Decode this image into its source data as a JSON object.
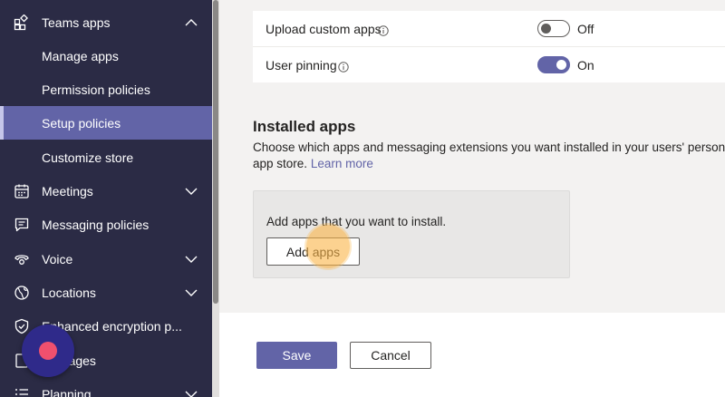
{
  "sidebar": {
    "items": [
      {
        "label": "Teams apps",
        "icon": "apps-icon",
        "chevron": "up"
      },
      {
        "label": "Manage apps"
      },
      {
        "label": "Permission policies"
      },
      {
        "label": "Setup policies",
        "selected": true
      },
      {
        "label": "Customize store"
      },
      {
        "label": "Meetings",
        "icon": "calendar-icon",
        "chevron": "down"
      },
      {
        "label": "Messaging policies",
        "icon": "chat-icon"
      },
      {
        "label": "Voice",
        "icon": "phone-icon",
        "chevron": "down"
      },
      {
        "label": "Locations",
        "icon": "globe-icon",
        "chevron": "down"
      },
      {
        "label": "Enhanced encryption p...",
        "icon": "shield-icon"
      },
      {
        "label": "packages",
        "icon": "package-icon"
      },
      {
        "label": "Planning",
        "icon": "list-icon",
        "chevron": "down"
      }
    ]
  },
  "settings": {
    "upload_custom_apps": {
      "label": "Upload custom apps",
      "state_text": "Off",
      "on": false
    },
    "user_pinning": {
      "label": "User pinning",
      "state_text": "On",
      "on": true
    }
  },
  "installed_apps": {
    "title": "Installed apps",
    "description_line1": "Choose which apps and messaging extensions you want installed in your users' personal Te",
    "description_line2": "app store.",
    "learn_more": "Learn more",
    "add_box_text": "Add apps that you want to install.",
    "add_apps_label": "Add apps"
  },
  "footer": {
    "save_label": "Save",
    "cancel_label": "Cancel"
  },
  "colors": {
    "sidebar_bg": "#2b2b45",
    "accent": "#6264a7",
    "record": "#f0506e",
    "highlight": "#fab446"
  }
}
